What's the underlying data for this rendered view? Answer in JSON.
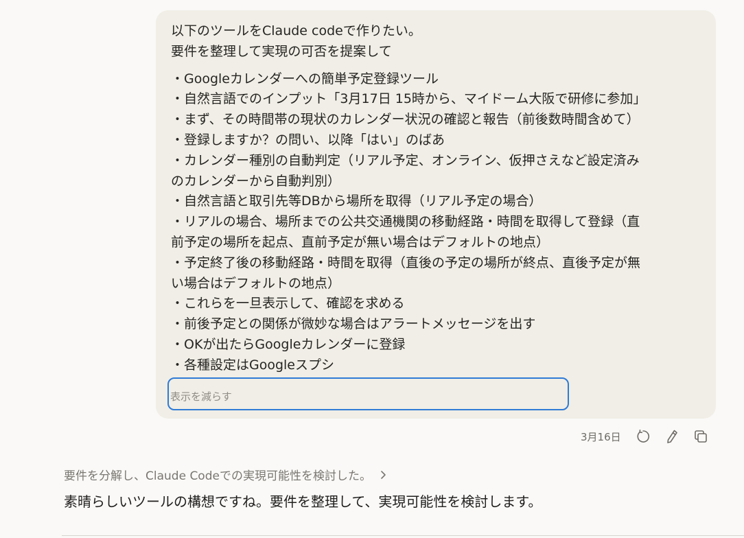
{
  "user_message": {
    "lines": [
      "以下のツールをClaude codeで作りたい。",
      "要件を整理して実現の可否を提案して",
      "",
      "・Googleカレンダーへの簡単予定登録ツール",
      "・自然言語でのインプット「3月17日 15時から、マイドーム大阪で研修に参加」",
      "・まず、その時間帯の現状のカレンダー状況の確認と報告（前後数時間含めて）",
      "・登録しますか？の問い、以降「はい」のばあ",
      "・カレンダー種別の自動判定（リアル予定、オンライン、仮押さえなど設定済み",
      "のカレンダーから自動判別）",
      "・自然言語と取引先等DBから場所を取得（リアル予定の場合）",
      "・リアルの場合、場所までの公共交通機関の移動経路・時間を取得して登録（直",
      "前予定の場所を起点、直前予定が無い場合はデフォルトの地点）",
      "・予定終了後の移動経路・時間を取得（直後の予定の場所が終点、直後予定が無",
      "い場合はデフォルトの地点）",
      "・これらを一旦表示して、確認を求める",
      "・前後予定との関係が微妙な場合はアラートメッセージを出す",
      "・OKが出たらGoogleカレンダーに登録",
      "・各種設定はGoogleスプシ"
    ],
    "collapse_label": "表示を減らす",
    "date": "3月16日"
  },
  "icons": {
    "retry": "retry-icon",
    "edit": "edit-icon",
    "copy": "copy-icon",
    "chevron": "chevron-right-icon"
  },
  "assistant": {
    "thinking_summary": "要件を分解し、Claude Codeでの実現可能性を検討した。",
    "response_first_line": "素晴らしいツールの構想ですね。要件を整理して、実現可能性を検討します。"
  },
  "colors": {
    "page_background": "#faf9f7",
    "bubble_background": "#f0eee6",
    "focus_ring": "#2f7ad6"
  }
}
